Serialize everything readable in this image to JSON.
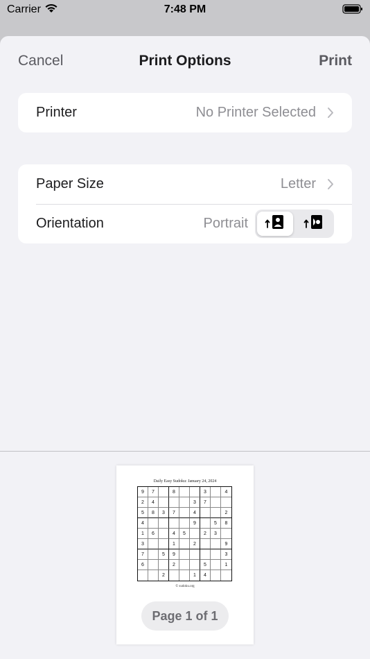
{
  "status": {
    "carrier": "Carrier",
    "time": "7:48 PM"
  },
  "nav": {
    "cancel": "Cancel",
    "title": "Print Options",
    "print": "Print"
  },
  "printer": {
    "label": "Printer",
    "value": "No Printer Selected"
  },
  "paper": {
    "label": "Paper Size",
    "value": "Letter"
  },
  "orientation": {
    "label": "Orientation",
    "value": "Portrait",
    "selected": "portrait"
  },
  "preview": {
    "title": "Daily Easy Sudoku: January 24,  2024",
    "credit": "© sudoku.org",
    "page_label": "Page 1 of 1",
    "grid": [
      [
        "9",
        "7",
        "",
        "8",
        "",
        "",
        "3",
        "",
        "4"
      ],
      [
        "2",
        "4",
        "",
        "",
        "",
        "3",
        "7",
        "",
        ""
      ],
      [
        "5",
        "8",
        "3",
        "7",
        "",
        "4",
        "",
        "",
        "2"
      ],
      [
        "4",
        "",
        "",
        "",
        "",
        "9",
        "",
        "5",
        "8"
      ],
      [
        "1",
        "6",
        "",
        "4",
        "5",
        "",
        "2",
        "3",
        ""
      ],
      [
        "3",
        "",
        "",
        "1",
        "",
        "2",
        "",
        "",
        "9"
      ],
      [
        "7",
        "",
        "5",
        "9",
        "",
        "",
        "",
        "",
        "3"
      ],
      [
        "6",
        "",
        "",
        "2",
        "",
        "",
        "5",
        "",
        "1"
      ],
      [
        "",
        "",
        "2",
        "",
        "",
        "1",
        "4",
        "",
        ""
      ]
    ]
  },
  "colors": {
    "accent_gray": "#5a5a60",
    "background": "#f2f2f6",
    "card": "#ffffff"
  }
}
